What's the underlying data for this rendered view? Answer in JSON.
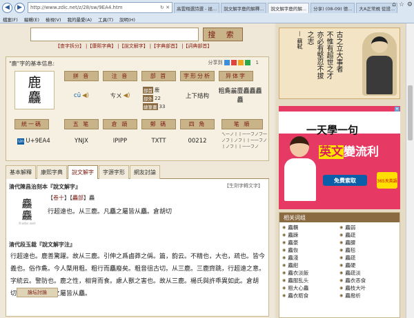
{
  "browser": {
    "url": "http://www.zdic.net/z/28/sw/9EA4.htm",
    "tabs": [
      "高雲翔選詩選 - 拯...",
      "說文解字鹿的解釋...",
      "說文解字鹿的解...",
      "分享) (08-09) 德...",
      "大A正常規 從證..."
    ],
    "menu": [
      "檔案(F)",
      "編輯(E)",
      "檢視(V)",
      "我的最愛(A)",
      "工具(T)",
      "說明(H)"
    ]
  },
  "search": {
    "placeholder": "",
    "button": "搜 索"
  },
  "dict_links": [
    "【查字拆分】",
    "|【康熙字典】",
    "|【說文解字】",
    "|【字典部首】",
    "|【詞典部首】"
  ],
  "info": {
    "title": "\"鹿\"字的基本信息:",
    "share_label": "分享到",
    "share_count": "1",
    "big_char_top": "鹿",
    "big_char_bottom": "麤",
    "labels": {
      "pinyin": "拼 音",
      "zhuyin": "注 音",
      "bushou": "部 首",
      "zixing": "字形分析",
      "yiti": "异体字",
      "tongyi": "統一碼",
      "wubi": "五 笔",
      "cangjie": "倉 頡",
      "zhengma": "鄭 碼",
      "sijiao": "四 角",
      "bishun": "笔 順"
    },
    "values": {
      "pinyin": "cū",
      "zhuyin": "ㄘㄨ",
      "bushou_tag": "部首",
      "bushou_val": "鹿",
      "bushou_strokes_tag": "部外",
      "bushou_strokes": "22",
      "total_strokes_tag": "總筆畫",
      "total_strokes": "33",
      "zixing": "上下结构",
      "yiti": "粗麁麄麆麤麤麤麤",
      "tongyi": "U+9EA4",
      "wubi": "YNJX",
      "cangjie": "IPIPP",
      "zhengma": "TXTT",
      "sijiao": "00212",
      "bishun": "ㄟ一ノ丨丨一一フノフ一ノフ丨ノフ丨丨一一フノ丨ノフ丨丨一一フノ"
    }
  },
  "tabs": [
    "基本解釋",
    "康熙字典",
    "說文解字",
    "字源字形",
    "網友討論"
  ],
  "content": {
    "section1": "清代陳昌治刻本『說文解字』",
    "gen_img": "【生劑字轉文字】",
    "seal_top": "麤",
    "seal_bottom": "麤",
    "seal_credit": "©zdic.net",
    "ref_prefix": "【",
    "ref_juan": "卷十",
    "ref_mid": "】【",
    "ref_bu": "麤部",
    "ref_suffix": "】麤",
    "sw_line": "行超遠也。从三鹿。凡麤之屬皆从麤。倉胡切",
    "section2": "清代段玉裁『說文解字注』",
    "para": "行超遠也。鹿善驚躍。故从三鹿。引伸之爲鹵莽之偁。篇，韵云。不精也，大也，疏也。皆今義也。俗作麁。今人槩用粗。粗行而麤廢矣。粗音徂古切。从三鹿。三鹿齊跳，行超遠之意。字統云。警防也。鹿之性，相背而食。慮人獸之害也。故从三鹿。楊氏與許乖異如此。倉胡切。五部。凡麤之屬皆从麤。",
    "discuss": "論坛討論"
  },
  "right": {
    "calli_lines": [
      "古之立大事者",
      "不惟有超世之才",
      "亦必有堅忍不拔",
      "之志",
      "— 蘇軾"
    ],
    "ad_top": "一天學一句",
    "ad_main": "英文",
    "ad_main_suffix": "變流利",
    "ad_btn": "免費索取",
    "ad_tag": "365天英語",
    "ad_x": "✕",
    "related_title": "相关词组",
    "related": [
      "麤糲",
      "麤弱",
      "麤踈",
      "麤疏",
      "麤豪",
      "麤腰",
      "麤恢",
      "麤毯",
      "麤淺",
      "麤疏",
      "麤紺",
      "麤硬",
      "麤衣淡飯",
      "麤疏淡",
      "麤服乱头",
      "麤衣恶食",
      "粗大心麤",
      "麤枝大叶",
      "麤衣粝食",
      "麤撥析"
    ]
  }
}
